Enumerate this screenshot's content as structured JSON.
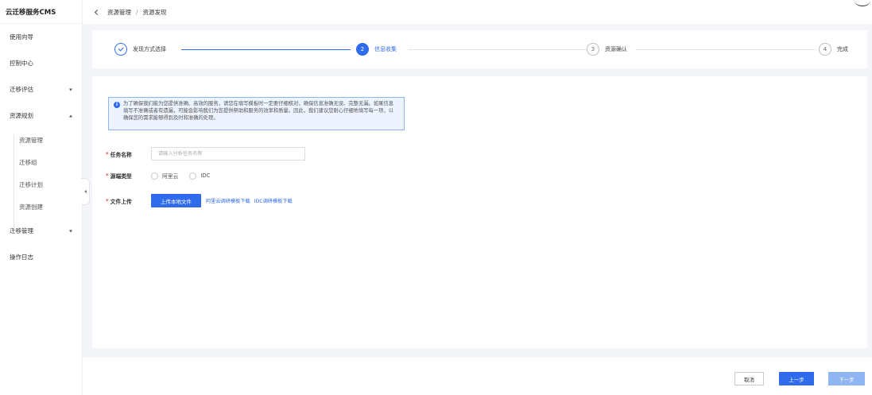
{
  "app": {
    "title": "云迁移服务CMS"
  },
  "sidebar": {
    "items": [
      {
        "label": "使用向导"
      },
      {
        "label": "控制中心"
      },
      {
        "label": "迁移评估"
      },
      {
        "label": "资源规划"
      },
      {
        "label": "迁移管理"
      },
      {
        "label": "操作日志"
      }
    ],
    "submenu": [
      {
        "label": "资源管理"
      },
      {
        "label": "迁移组"
      },
      {
        "label": "迁移计划"
      },
      {
        "label": "资源创建"
      }
    ]
  },
  "breadcrumb": {
    "first": "资源管理",
    "separator": "/",
    "current": "资源发现"
  },
  "steps": [
    {
      "number": "1",
      "label": "发现方式选择",
      "status": "done"
    },
    {
      "number": "2",
      "label": "信息收集",
      "status": "active"
    },
    {
      "number": "3",
      "label": "资源确认",
      "status": "pending"
    },
    {
      "number": "4",
      "label": "完成",
      "status": "pending"
    }
  ],
  "notice": {
    "icon": "info-icon",
    "text": "为了确保我们能为您提供准确、高效的服务，请您在填写模板时一定要仔细核对，确保信息准确无误、完整无漏。如果信息填写不准确或者有遗漏，可能会影响我们为您提供帮助和服务的效率和质量。因此，我们建议您耐心仔细地填写每一项，以确保您的需求能够得到及时和准确的处理。"
  },
  "form": {
    "task_name": {
      "label": "任务名称",
      "value": "",
      "placeholder": "请输入分析任务名称"
    },
    "source_type": {
      "label": "源端类型",
      "options": [
        "阿里云",
        "IDC"
      ]
    },
    "file_upload": {
      "label": "文件上传",
      "button": "上传本地文件",
      "links": [
        "阿里云调研模板下载",
        "IDC调研模板下载"
      ]
    }
  },
  "footer": {
    "cancel": "取消",
    "prev": "上一步",
    "next": "下一步"
  },
  "colors": {
    "accent": "#2f6bea",
    "accent_disabled": "#8fb6f3",
    "required": "#e5484d",
    "notice_bg": "#eef4ff"
  }
}
